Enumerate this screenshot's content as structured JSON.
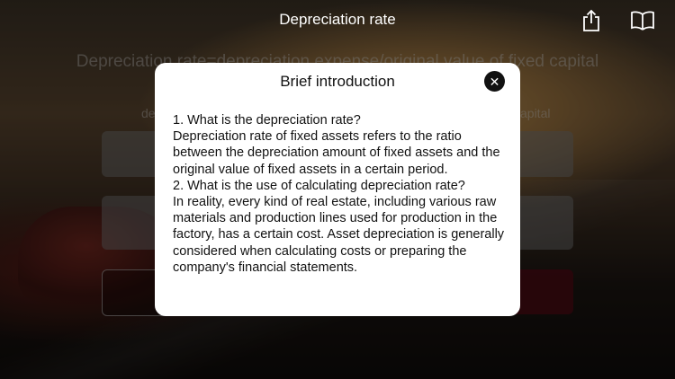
{
  "header": {
    "title": "Depreciation rate",
    "share_icon": "share-icon",
    "book_icon": "book-icon"
  },
  "background": {
    "formula": "Depreciation rate=depreciation expense/original value of fixed capital",
    "hint_left": "de",
    "hint_right": "apital"
  },
  "modal": {
    "title": "Brief introduction",
    "close_icon": "close-icon",
    "paragraphs": [
      "1. What is the depreciation rate?",
      "Depreciation rate of fixed assets refers to the ratio between the depreciation amount of fixed assets and the original value of fixed assets in a certain period.",
      "2. What is the use of calculating depreciation rate?",
      "In reality, every kind of real estate, including various raw materials and production lines used for production in the factory, has a certain cost. Asset depreciation is generally considered when calculating costs or preparing the company's financial statements."
    ]
  },
  "colors": {
    "accent_button": "#500a14",
    "modal_bg": "#ffffff"
  }
}
